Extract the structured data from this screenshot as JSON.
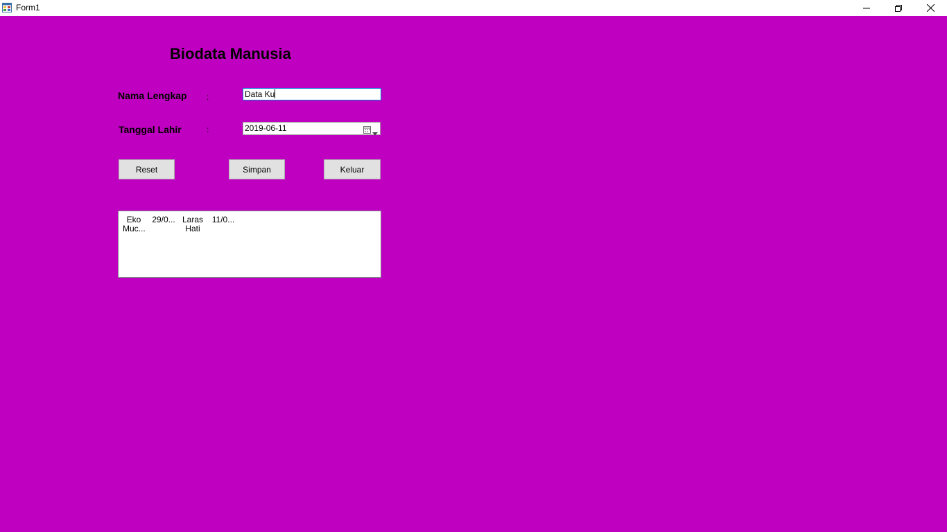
{
  "window": {
    "title": "Form1",
    "icon": "form-app-icon",
    "controls": {
      "minimize_icon": "minimize-icon",
      "maximize_icon": "restore-icon",
      "close_icon": "close-icon"
    }
  },
  "form": {
    "background_color": "#c000c0",
    "title": "Biodata Manusia",
    "fields": {
      "nama": {
        "label": "Nama Lengkap",
        "colon": ":",
        "value": "Data Ku"
      },
      "tanggal": {
        "label": "Tanggal Lahir",
        "colon": ":",
        "value": "2019-06-11",
        "icon": "calendar-icon"
      }
    },
    "buttons": {
      "reset": "Reset",
      "simpan": "Simpan",
      "keluar": "Keluar"
    },
    "list": {
      "items": [
        {
          "line1": "Eko",
          "line2": "Muc..."
        },
        {
          "line1": "29/0...",
          "line2": ""
        },
        {
          "line1": "Laras",
          "line2": "Hati"
        },
        {
          "line1": "11/0...",
          "line2": ""
        }
      ]
    }
  }
}
